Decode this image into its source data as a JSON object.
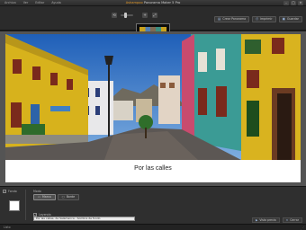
{
  "window": {
    "title_brand": "Ashampoo",
    "title_text": "Panorama Maker 5 Pro",
    "controls": [
      "–",
      "□",
      "✕"
    ]
  },
  "menu": [
    "Archivo",
    "Ver",
    "Editar",
    "Ayuda"
  ],
  "toolbar": {
    "icons": [
      "rotate-left-icon",
      "zoom-out-icon",
      "zoom-in-icon",
      "fit-icon"
    ],
    "buttons": [
      {
        "label": "Crear Panorama",
        "glyph": "▤"
      },
      {
        "label": "Imprimir",
        "glyph": "⎙"
      },
      {
        "label": "Guardar",
        "glyph": "▣"
      }
    ]
  },
  "canvas": {
    "caption": "Por las calles"
  },
  "photo_palette": {
    "sky": "#2a6cc4",
    "yellow_wall": "#d7b21c",
    "teal_wall": "#3b9b95",
    "street": "#5c5754"
  },
  "bottom": {
    "background_label": "Fondo",
    "mode_label": "Modo",
    "mode_buttons": [
      {
        "label": "Marco",
        "glyph": "▭",
        "active": true
      },
      {
        "label": "Borde",
        "glyph": "▢",
        "active": false
      }
    ],
    "caption_checkbox_label": "Leyenda",
    "caption_field_value": "Por las calles, de Salamanca - Sombra de fondo",
    "right_buttons": [
      {
        "label": "Vista previa",
        "glyph": "▶"
      },
      {
        "label": "Cerrar",
        "glyph": "✕"
      }
    ]
  },
  "status": {
    "text": "Listo"
  }
}
